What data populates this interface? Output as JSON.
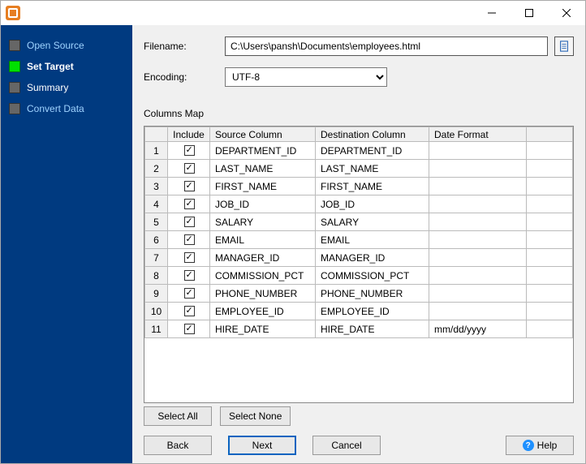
{
  "window": {
    "title": ""
  },
  "sidebar": {
    "items": [
      {
        "label": "Open Source",
        "active": false,
        "style": "link"
      },
      {
        "label": "Set Target",
        "active": true,
        "style": "bold"
      },
      {
        "label": "Summary",
        "active": false,
        "style": "plain"
      },
      {
        "label": "Convert Data",
        "active": false,
        "style": "link"
      }
    ]
  },
  "form": {
    "filename_label": "Filename:",
    "filename_value": "C:\\Users\\pansh\\Documents\\employees.html",
    "browse_icon": "document-icon",
    "encoding_label": "Encoding:",
    "encoding_value": "UTF-8",
    "encoding_options": [
      "UTF-8"
    ]
  },
  "columns_map": {
    "section_label": "Columns Map",
    "headers": {
      "rownum": "",
      "include": "Include",
      "source": "Source Column",
      "dest": "Destination Column",
      "date_fmt": "Date Format"
    },
    "rows": [
      {
        "n": "1",
        "include": true,
        "source": "DEPARTMENT_ID",
        "dest": "DEPARTMENT_ID",
        "date_fmt": ""
      },
      {
        "n": "2",
        "include": true,
        "source": "LAST_NAME",
        "dest": "LAST_NAME",
        "date_fmt": ""
      },
      {
        "n": "3",
        "include": true,
        "source": "FIRST_NAME",
        "dest": "FIRST_NAME",
        "date_fmt": ""
      },
      {
        "n": "4",
        "include": true,
        "source": "JOB_ID",
        "dest": "JOB_ID",
        "date_fmt": ""
      },
      {
        "n": "5",
        "include": true,
        "source": "SALARY",
        "dest": "SALARY",
        "date_fmt": ""
      },
      {
        "n": "6",
        "include": true,
        "source": "EMAIL",
        "dest": "EMAIL",
        "date_fmt": ""
      },
      {
        "n": "7",
        "include": true,
        "source": "MANAGER_ID",
        "dest": "MANAGER_ID",
        "date_fmt": ""
      },
      {
        "n": "8",
        "include": true,
        "source": "COMMISSION_PCT",
        "dest": "COMMISSION_PCT",
        "date_fmt": ""
      },
      {
        "n": "9",
        "include": true,
        "source": "PHONE_NUMBER",
        "dest": "PHONE_NUMBER",
        "date_fmt": ""
      },
      {
        "n": "10",
        "include": true,
        "source": "EMPLOYEE_ID",
        "dest": "EMPLOYEE_ID",
        "date_fmt": ""
      },
      {
        "n": "11",
        "include": true,
        "source": "HIRE_DATE",
        "dest": "HIRE_DATE",
        "date_fmt": "mm/dd/yyyy"
      }
    ]
  },
  "buttons": {
    "select_all": "Select All",
    "select_none": "Select None",
    "back": "Back",
    "next": "Next",
    "cancel": "Cancel",
    "help": "Help"
  }
}
